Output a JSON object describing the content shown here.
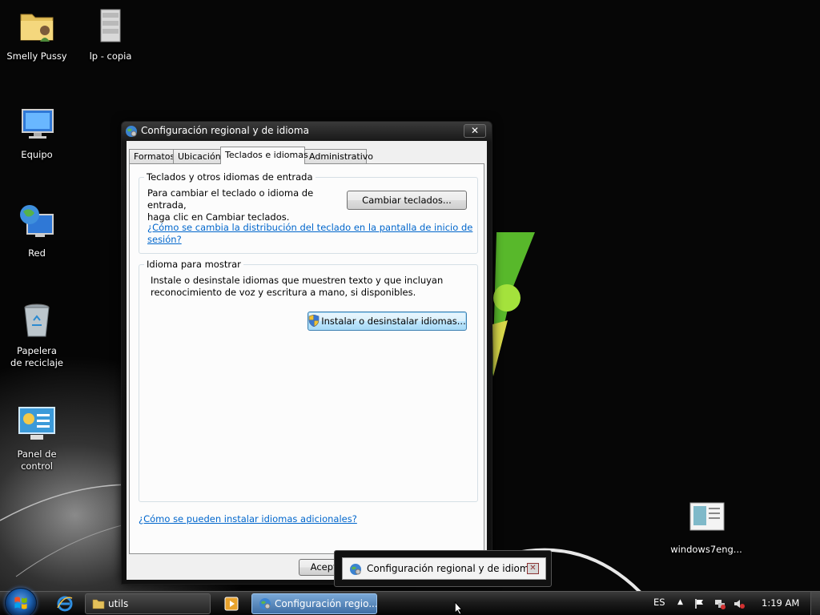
{
  "desktop": {
    "icons": [
      {
        "label": "Smelly Pussy",
        "icon": "folder-icon"
      },
      {
        "label": "lp - copia",
        "icon": "archive-icon"
      },
      {
        "label": "Equipo",
        "icon": "computer-icon"
      },
      {
        "label": "Red",
        "icon": "network-icon"
      },
      {
        "label": "Papelera de reciclaje",
        "icon": "recycle-bin-icon"
      },
      {
        "label": "Panel de control",
        "icon": "control-panel-icon"
      },
      {
        "label": "windows7eng...",
        "icon": "document-file-icon"
      }
    ]
  },
  "dialog": {
    "title": "Configuración regional y de idioma",
    "close_symbol": "✕",
    "tabs": [
      {
        "label": "Formatos"
      },
      {
        "label": "Ubicación"
      },
      {
        "label": "Teclados e idiomas",
        "active": true
      },
      {
        "label": "Administrativo"
      }
    ],
    "keyboards_group": {
      "title": "Teclados y otros idiomas de entrada",
      "description_line1": "Para cambiar el teclado o idioma de entrada,",
      "description_line2": "haga clic en Cambiar teclados.",
      "change_keyboards_button": "Cambiar teclados...",
      "help_link_line1": "¿Cómo se cambia la distribución del teclado en la pantalla de inicio de",
      "help_link_line2": "sesión?"
    },
    "display_language_group": {
      "title": "Idioma para mostrar",
      "description_line1": "Instale o desinstale idiomas que muestren texto y que incluyan",
      "description_line2": "reconocimiento de voz y escritura a mano, si disponibles.",
      "install_button": "Instalar o desinstalar idiomas..."
    },
    "additional_languages_link": "¿Cómo se pueden instalar idiomas adicionales?",
    "accept_button": "Aceptar"
  },
  "thumbnail_tooltip": {
    "title": "Configuración regional y de idioma",
    "close_symbol": "✕"
  },
  "taskbar": {
    "buttons": [
      {
        "label": "utils",
        "icon": "folder-icon"
      },
      {
        "label": "Configuración regio...",
        "icon": "globe-settings-icon"
      }
    ],
    "language": "ES",
    "clock": "1:19 AM"
  }
}
